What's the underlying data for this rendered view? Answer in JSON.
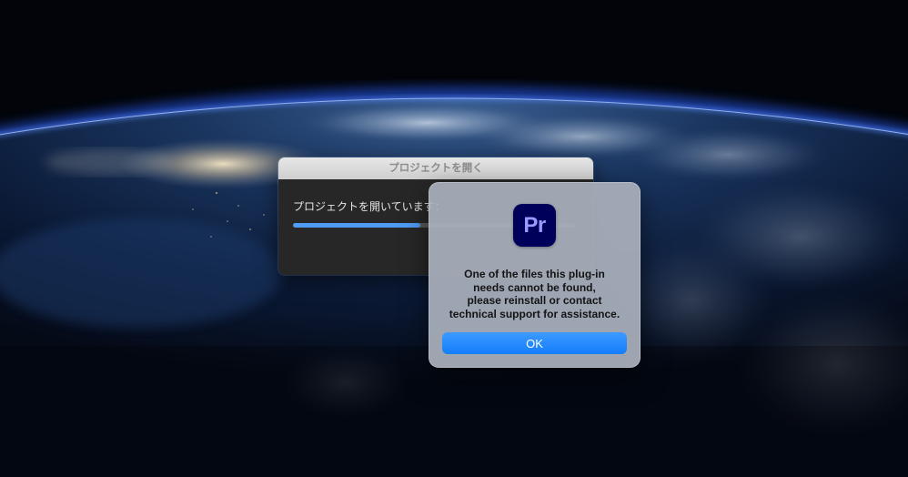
{
  "background": {
    "scene": "earth-from-orbit",
    "colors": {
      "space": "#020409",
      "atmosphere": "#2b6cff",
      "ocean": "#0b1d3d"
    }
  },
  "progress_window": {
    "title": "プロジェクトを開く",
    "status_text": "プロジェクトを開いています：",
    "progress": 0.45,
    "colors": {
      "fill": "#4f9cf4",
      "track": "#5a5a5a",
      "body": "#272727"
    }
  },
  "alert": {
    "app_icon": {
      "name": "premiere-pro-app-icon",
      "text": "Pr",
      "bg": "#00005b",
      "fg": "#9999ff"
    },
    "message_lines": [
      "One of the files this plug-in",
      "needs cannot be found,",
      "please reinstall or contact",
      "technical support for assistance."
    ],
    "ok_label": "OK",
    "colors": {
      "button": "#147dfb"
    }
  }
}
